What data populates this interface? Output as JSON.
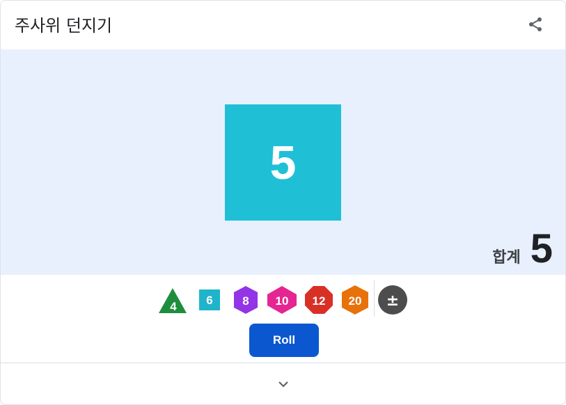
{
  "header": {
    "title": "주사위 던지기",
    "share_icon": "share-icon"
  },
  "stage": {
    "background": "#e8f0fe",
    "die": {
      "sides": 6,
      "value": "5",
      "color": "#1fc0d6"
    },
    "total_label": "합계",
    "total_value": "5"
  },
  "dice_options": [
    {
      "name": "d4",
      "label": "4",
      "color": "#1e8e3e"
    },
    {
      "name": "d6",
      "label": "6",
      "color": "#1fb4c9"
    },
    {
      "name": "d8",
      "label": "8",
      "color": "#9334e6"
    },
    {
      "name": "d10",
      "label": "10",
      "color": "#e52592"
    },
    {
      "name": "d12",
      "label": "12",
      "color": "#d93025"
    },
    {
      "name": "d20",
      "label": "20",
      "color": "#e8710a"
    },
    {
      "name": "modifier",
      "label": "±",
      "color": "#4d4d4d"
    }
  ],
  "roll_button": {
    "label": "Roll",
    "color": "#0b57d0"
  },
  "footer": {
    "expand_icon": "chevron-down-icon"
  }
}
